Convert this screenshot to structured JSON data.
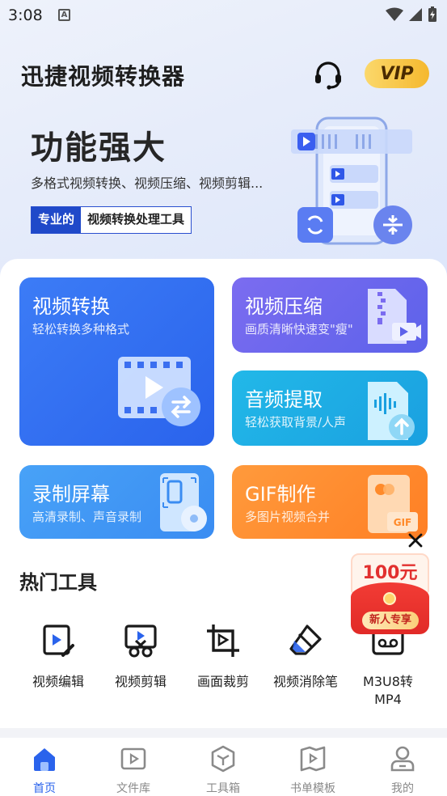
{
  "status_bar": {
    "time": "3:08",
    "notification_icon": "A"
  },
  "header": {
    "app_title": "迅捷视频转换器",
    "vip_label": "VIP"
  },
  "hero": {
    "title": "功能强大",
    "subtitle": "多格式视频转换、视频压缩、视频剪辑...",
    "tag_highlight": "专业的",
    "tag_text": "视频转换处理工具"
  },
  "feature_cards": [
    {
      "title": "视频转换",
      "subtitle": "轻松转换多种格式",
      "icon": "video-convert-icon"
    },
    {
      "title": "视频压缩",
      "subtitle": "画质清晰快速变\"瘦\"",
      "icon": "zip-video-icon"
    },
    {
      "title": "音频提取",
      "subtitle": "轻松获取背景/人声",
      "icon": "audio-extract-icon"
    },
    {
      "title": "录制屏幕",
      "subtitle": "高清录制、声音录制",
      "icon": "screen-record-icon"
    },
    {
      "title": "GIF制作",
      "subtitle": "多图片视频合并",
      "icon": "gif-icon"
    }
  ],
  "hot_tools": {
    "title": "热门工具",
    "items": [
      {
        "label": "视频编辑",
        "icon": "video-edit-icon"
      },
      {
        "label": "视频剪辑",
        "icon": "video-cut-icon"
      },
      {
        "label": "画面裁剪",
        "icon": "crop-icon"
      },
      {
        "label": "视频消除笔",
        "icon": "eraser-icon"
      },
      {
        "label": "M3U8转\nMP4",
        "icon": "m3u8-icon"
      }
    ]
  },
  "promo": {
    "amount": "100元",
    "button": "新人专享"
  },
  "bottom_nav": {
    "items": [
      {
        "label": "首页",
        "icon": "home-icon",
        "active": true
      },
      {
        "label": "文件库",
        "icon": "file-library-icon",
        "active": false
      },
      {
        "label": "工具箱",
        "icon": "toolbox-icon",
        "active": false
      },
      {
        "label": "书单模板",
        "icon": "booklist-template-icon",
        "active": false
      },
      {
        "label": "我的",
        "icon": "profile-icon",
        "active": false
      }
    ]
  },
  "colors": {
    "primary": "#2a63ec",
    "vip_gold": "#f5b82e",
    "promo_red": "#e12a27"
  }
}
